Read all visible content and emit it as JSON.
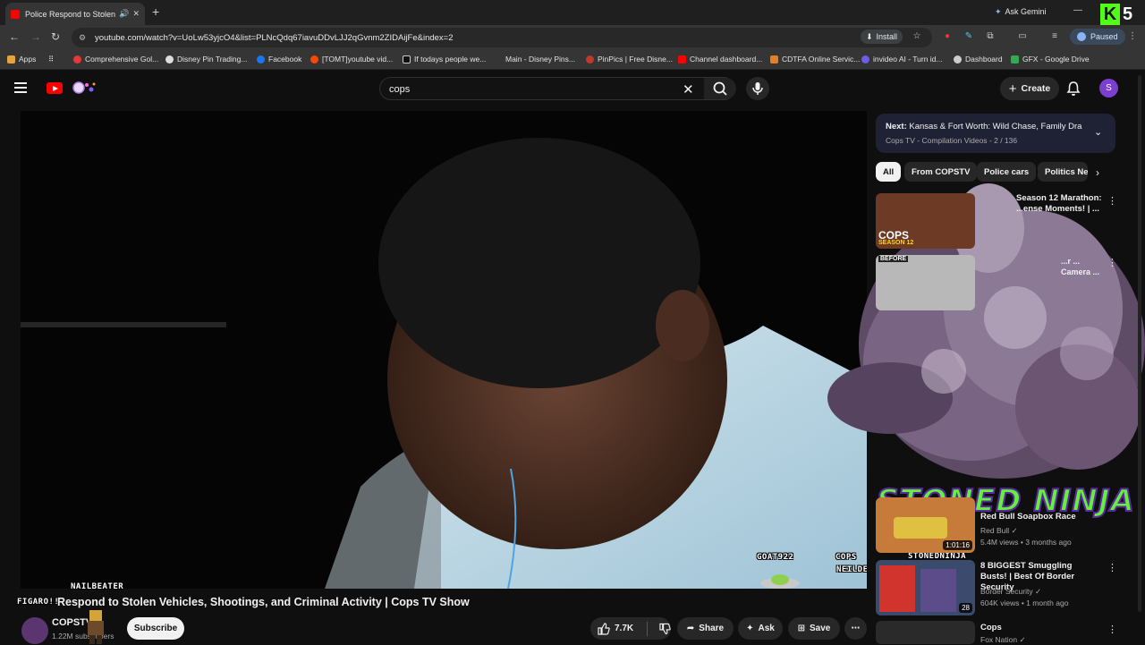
{
  "browser": {
    "tab_title": "Police Respond to Stolen Ve",
    "gemini_label": "Ask Gemini",
    "kick_digit": "5",
    "url": "youtube.com/watch?v=UoLw53yjcO4&list=PLNcQdq67iavuDDvLJJ2qGvnm2ZIDAijFe&index=2",
    "install_label": "Install",
    "paused_label": "Paused",
    "bookmarks": [
      "Apps",
      "Comprehensive Gol...",
      "Disney Pin Trading...",
      "Facebook",
      "[TOMT]youtube vid...",
      "If todays people we...",
      "Main - Disney Pins...",
      "PinPics | Free Disne...",
      "Channel dashboard...",
      "CDTFA Online Servic...",
      "invideo AI - Turn id...",
      "Dashboard",
      "GFX - Google Drive"
    ]
  },
  "youtube": {
    "search_query": "cops",
    "create_label": "Create",
    "avatar_letter": "S"
  },
  "player": {
    "overlay_goat": "GOAT922",
    "overlay_cops": "COPS",
    "overlay_neil": "NEILDEGRASSETYRONE",
    "overlay_nail": "NAILBEATER",
    "overlay_figaro": "FIGARO!!",
    "overlay_stoned": "STONED NINJA",
    "overlay_stonedninja": "STONEDNINJA"
  },
  "video": {
    "title": "Respond to Stolen Vehicles, Shootings, and Criminal Activity | Cops TV Show",
    "channel": "COPSTV",
    "subscribers": "1.22M subscribers",
    "subscribe_label": "Subscribe",
    "likes": "7.7K",
    "share_label": "Share",
    "ask_label": "Ask",
    "save_label": "Save"
  },
  "sidebar": {
    "next_prefix": "Next:",
    "next_title": "Kansas & Fort Worth: Wild Chase, Family Dra...",
    "next_meta": "Cops TV - Compilation Videos - 2 / 136",
    "chips": [
      "All",
      "From COPSTV",
      "Police cars",
      "Politics News"
    ],
    "recs": [
      {
        "title": "Season 12 Marathon: ...ense Moments! | ...",
        "thumb_text": "COPS",
        "thumb_sub": "SEASON 12"
      },
      {
        "title": "...r ... Camera ...",
        "thumb_text": "BEFORE"
      },
      {
        "title": "Red Bull Soapbox Race",
        "channel": "Red Bull",
        "meta": "5.4M views • 3 months ago",
        "duration": "1:01:16"
      },
      {
        "title": "8 BIGGEST Smuggling Busts! | Best Of Border Security",
        "channel": "Border Security",
        "meta": "604K views • 1 month ago",
        "duration": "28"
      },
      {
        "title": "Cops",
        "channel": "Fox Nation"
      }
    ]
  },
  "colors": {
    "yt_red": "#ff0000",
    "kick_green": "#53fc18",
    "ninja_green": "#64f03c",
    "ninja_outline": "#5a2a9e"
  }
}
